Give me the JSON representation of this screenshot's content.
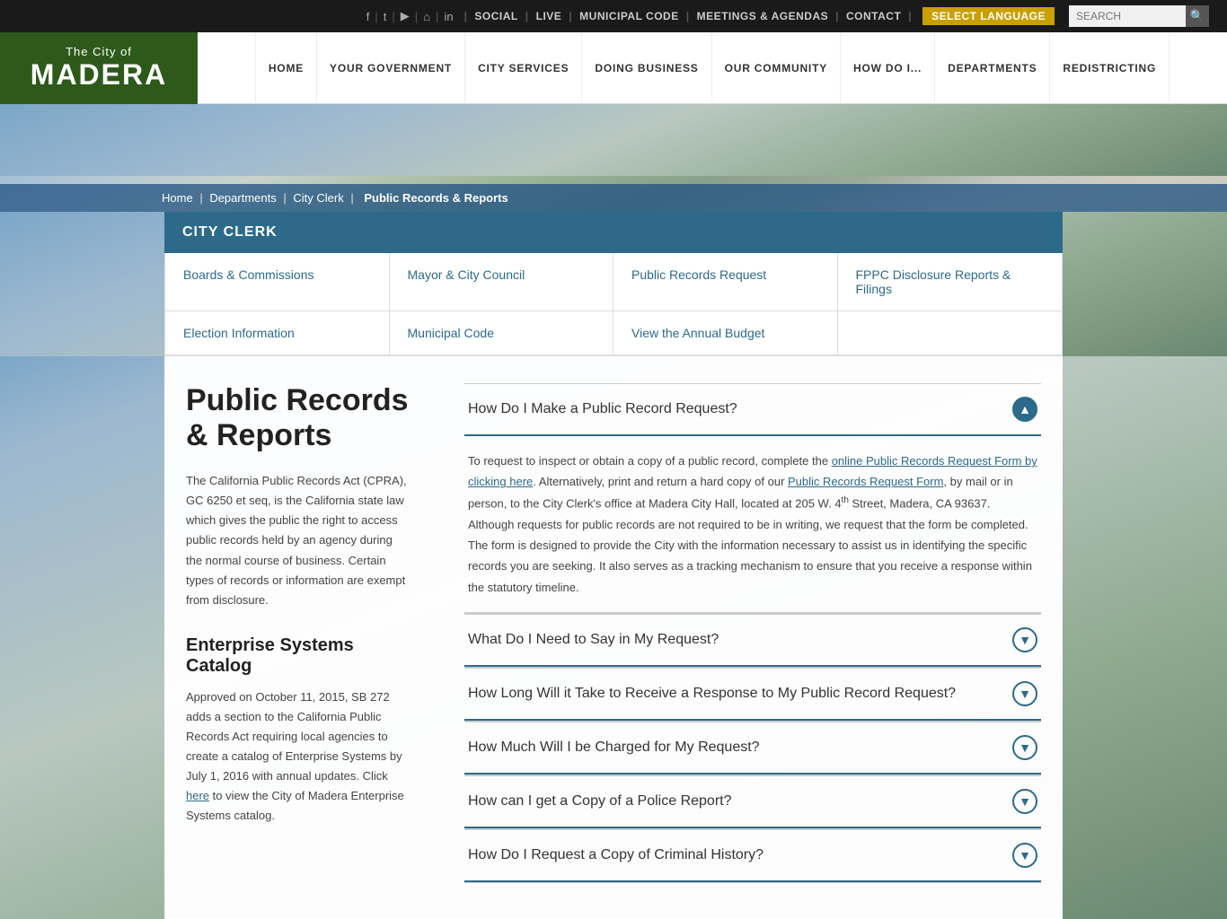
{
  "topbar": {
    "icons": [
      "f",
      "t",
      "▶",
      "⌂",
      "in"
    ],
    "links": [
      "SOCIAL",
      "LIVE",
      "MUNICIPAL CODE",
      "MEETINGS & AGENDAS",
      "CONTACT"
    ],
    "lang_label": "SELECT LANGUAGE",
    "search_placeholder": "SEARCH"
  },
  "header": {
    "logo_city_of": "The City of",
    "logo_city_name": "MADERA",
    "nav_items": [
      "HOME",
      "YOUR GOVERNMENT",
      "CITY SERVICES",
      "DOING BUSINESS",
      "OUR COMMUNITY",
      "HOW DO I...",
      "DEPARTMENTS",
      "REDISTRICTING"
    ]
  },
  "breadcrumb": {
    "items": [
      "Home",
      "Departments",
      "City Clerk",
      "Public Records & Reports"
    ]
  },
  "dept": {
    "title": "CITY CLERK",
    "nav": [
      {
        "label": "Boards & Commissions"
      },
      {
        "label": "Mayor & City Council"
      },
      {
        "label": "Public Records Request"
      },
      {
        "label": "FPPC Disclosure Reports & Filings"
      },
      {
        "label": "Election Information"
      },
      {
        "label": "Municipal Code"
      },
      {
        "label": "View the Annual Budget"
      },
      {
        "label": ""
      }
    ]
  },
  "page": {
    "title": "Public Records & Reports",
    "description": "The California Public Records Act (CPRA), GC 6250 et seq, is the California state law which gives the public the right to access public records held by an agency during the normal course of business. Certain types of records or information are exempt from disclosure.",
    "enterprise_heading": "Enterprise Systems Catalog",
    "enterprise_text": "Approved on October 11, 2015, SB 272 adds a section to the California Public Records Act requiring local agencies to create a catalog of Enterprise Systems by July 1, 2016 with annual updates. Click here to view the City of Madera Enterprise Systems catalog."
  },
  "accordion": {
    "items": [
      {
        "title": "How Do I Make a Public Record Request?",
        "open": true,
        "body": "To request to inspect or obtain a copy of a public record, complete the online Public Records Request Form by clicking here. Alternatively, print and return a hard copy of our Public Records Request Form, by mail or in person, to the City Clerk's office at Madera City Hall, located at 205 W. 4th Street, Madera, CA 93637. Although requests for public records are not required to be in writing, we request that the form be completed. The form is designed to provide the City with the information necessary to assist us in identifying the specific records you are seeking. It also serves as a tracking mechanism to ensure that you receive a response within the statutory timeline."
      },
      {
        "title": "What Do I Need to Say in My Request?",
        "open": false,
        "body": ""
      },
      {
        "title": "How Long Will it Take to Receive a Response to My Public Record Request?",
        "open": false,
        "body": ""
      },
      {
        "title": "How Much Will I be Charged for My Request?",
        "open": false,
        "body": ""
      },
      {
        "title": "How can I get a Copy of a Police Report?",
        "open": false,
        "body": ""
      },
      {
        "title": "How Do I Request a Copy of Criminal History?",
        "open": false,
        "body": ""
      }
    ]
  }
}
